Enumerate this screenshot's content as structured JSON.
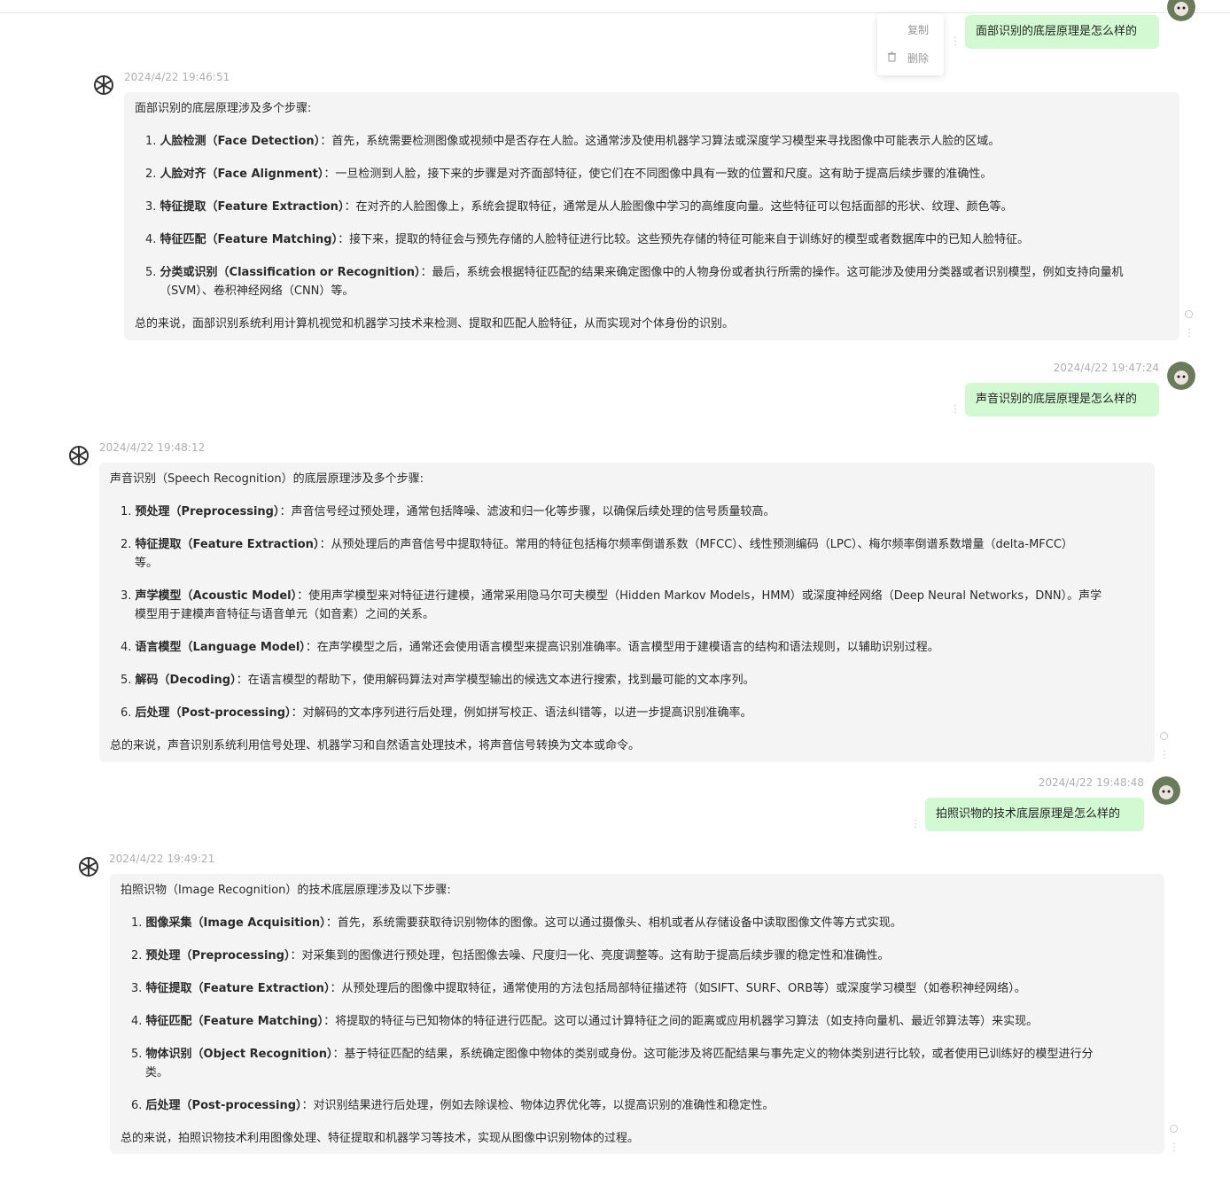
{
  "context_menu": {
    "copy": "复制",
    "delete": "删除"
  },
  "conversation": [
    {
      "role": "user",
      "text": "面部识别的底层原理是怎么样的"
    },
    {
      "role": "ai",
      "timestamp": "2024/4/22 19:46:51",
      "intro": "面部识别的底层原理涉及多个步骤:",
      "items": [
        {
          "num": "1.",
          "title": "人脸检测（Face Detection）",
          "text": "：首先，系统需要检测图像或视频中是否存在人脸。这通常涉及使用机器学习算法或深度学习模型来寻找图像中可能表示人脸的区域。"
        },
        {
          "num": "2.",
          "title": "人脸对齐（Face Alignment）",
          "text": "：一旦检测到人脸，接下来的步骤是对齐面部特征，使它们在不同图像中具有一致的位置和尺度。这有助于提高后续步骤的准确性。"
        },
        {
          "num": "3.",
          "title": "特征提取（Feature Extraction）",
          "text": "：在对齐的人脸图像上，系统会提取特征，通常是从人脸图像中学习的高维度向量。这些特征可以包括面部的形状、纹理、颜色等。"
        },
        {
          "num": "4.",
          "title": "特征匹配（Feature Matching）",
          "text": "：接下来，提取的特征会与预先存储的人脸特征进行比较。这些预先存储的特征可能来自于训练好的模型或者数据库中的已知人脸特征。"
        },
        {
          "num": "5.",
          "title": "分类或识别（Classification or Recognition）",
          "text": "：最后，系统会根据特征匹配的结果来确定图像中的人物身份或者执行所需的操作。这可能涉及使用分类器或者识别模型，例如支持向量机",
          "cont": "（SVM）、卷积神经网络（CNN）等。"
        }
      ],
      "summary": "总的来说，面部识别系统利用计算机视觉和机器学习技术来检测、提取和匹配人脸特征，从而实现对个体身份的识别。"
    },
    {
      "role": "user",
      "timestamp": "2024/4/22 19:47:24",
      "text": "声音识别的底层原理是怎么样的"
    },
    {
      "role": "ai",
      "timestamp": "2024/4/22 19:48:12",
      "intro": "声音识别（Speech Recognition）的底层原理涉及多个步骤:",
      "items": [
        {
          "num": "1.",
          "title": "预处理（Preprocessing）",
          "text": "：声音信号经过预处理，通常包括降噪、滤波和归一化等步骤，以确保后续处理的信号质量较高。"
        },
        {
          "num": "2.",
          "title": "特征提取（Feature Extraction）",
          "text": "：从预处理后的声音信号中提取特征。常用的特征包括梅尔频率倒谱系数（MFCC）、线性预测编码（LPC）、梅尔频率倒谱系数增量（delta-MFCC）",
          "cont": "等。"
        },
        {
          "num": "3.",
          "title": "声学模型（Acoustic Model）",
          "text": "：使用声学模型来对特征进行建模，通常采用隐马尔可夫模型（Hidden Markov Models，HMM）或深度神经网络（Deep Neural Networks，DNN）。声学",
          "cont": "模型用于建模声音特征与语音单元（如音素）之间的关系。"
        },
        {
          "num": "4.",
          "title": "语言模型（Language Model）",
          "text": "：在声学模型之后，通常还会使用语言模型来提高识别准确率。语言模型用于建模语言的结构和语法规则，以辅助识别过程。"
        },
        {
          "num": "5.",
          "title": "解码（Decoding）",
          "text": "：在语言模型的帮助下，使用解码算法对声学模型输出的候选文本进行搜索，找到最可能的文本序列。"
        },
        {
          "num": "6.",
          "title": "后处理（Post-processing）",
          "text": "：对解码的文本序列进行后处理，例如拼写校正、语法纠错等，以进一步提高识别准确率。"
        }
      ],
      "summary": "总的来说，声音识别系统利用信号处理、机器学习和自然语言处理技术，将声音信号转换为文本或命令。"
    },
    {
      "role": "user",
      "timestamp": "2024/4/22 19:48:48",
      "text": "拍照识物的技术底层原理是怎么样的"
    },
    {
      "role": "ai",
      "timestamp": "2024/4/22 19:49:21",
      "intro": "拍照识物（Image Recognition）的技术底层原理涉及以下步骤:",
      "items": [
        {
          "num": "1.",
          "title": "图像采集（Image Acquisition）",
          "text": "：首先，系统需要获取待识别物体的图像。这可以通过摄像头、相机或者从存储设备中读取图像文件等方式实现。"
        },
        {
          "num": "2.",
          "title": "预处理（Preprocessing）",
          "text": "：对采集到的图像进行预处理，包括图像去噪、尺度归一化、亮度调整等。这有助于提高后续步骤的稳定性和准确性。"
        },
        {
          "num": "3.",
          "title": "特征提取（Feature Extraction）",
          "text": "：从预处理后的图像中提取特征，通常使用的方法包括局部特征描述符（如SIFT、SURF、ORB等）或深度学习模型（如卷积神经网络）。"
        },
        {
          "num": "4.",
          "title": "特征匹配（Feature Matching）",
          "text": "：将提取的特征与已知物体的特征进行匹配。这可以通过计算特征之间的距离或应用机器学习算法（如支持向量机、最近邻算法等）来实现。"
        },
        {
          "num": "5.",
          "title": "物体识别（Object Recognition）",
          "text": "：基于特征匹配的结果，系统确定图像中物体的类别或身份。这可能涉及将匹配结果与事先定义的物体类别进行比较，或者使用已训练好的模型进行分",
          "cont": "类。"
        },
        {
          "num": "6.",
          "title": "后处理（Post-processing）",
          "text": "：对识别结果进行后处理，例如去除误检、物体边界优化等，以提高识别的准确性和稳定性。"
        }
      ],
      "summary": "总的来说，拍照识物技术利用图像处理、特征提取和机器学习等技术，实现从图像中识别物体的过程。"
    }
  ],
  "icons": {
    "ai": "openai-logo-icon",
    "user": "user-avatar-icon",
    "more": "more-vertical-icon",
    "copy": "copy-icon",
    "delete": "trash-icon"
  }
}
